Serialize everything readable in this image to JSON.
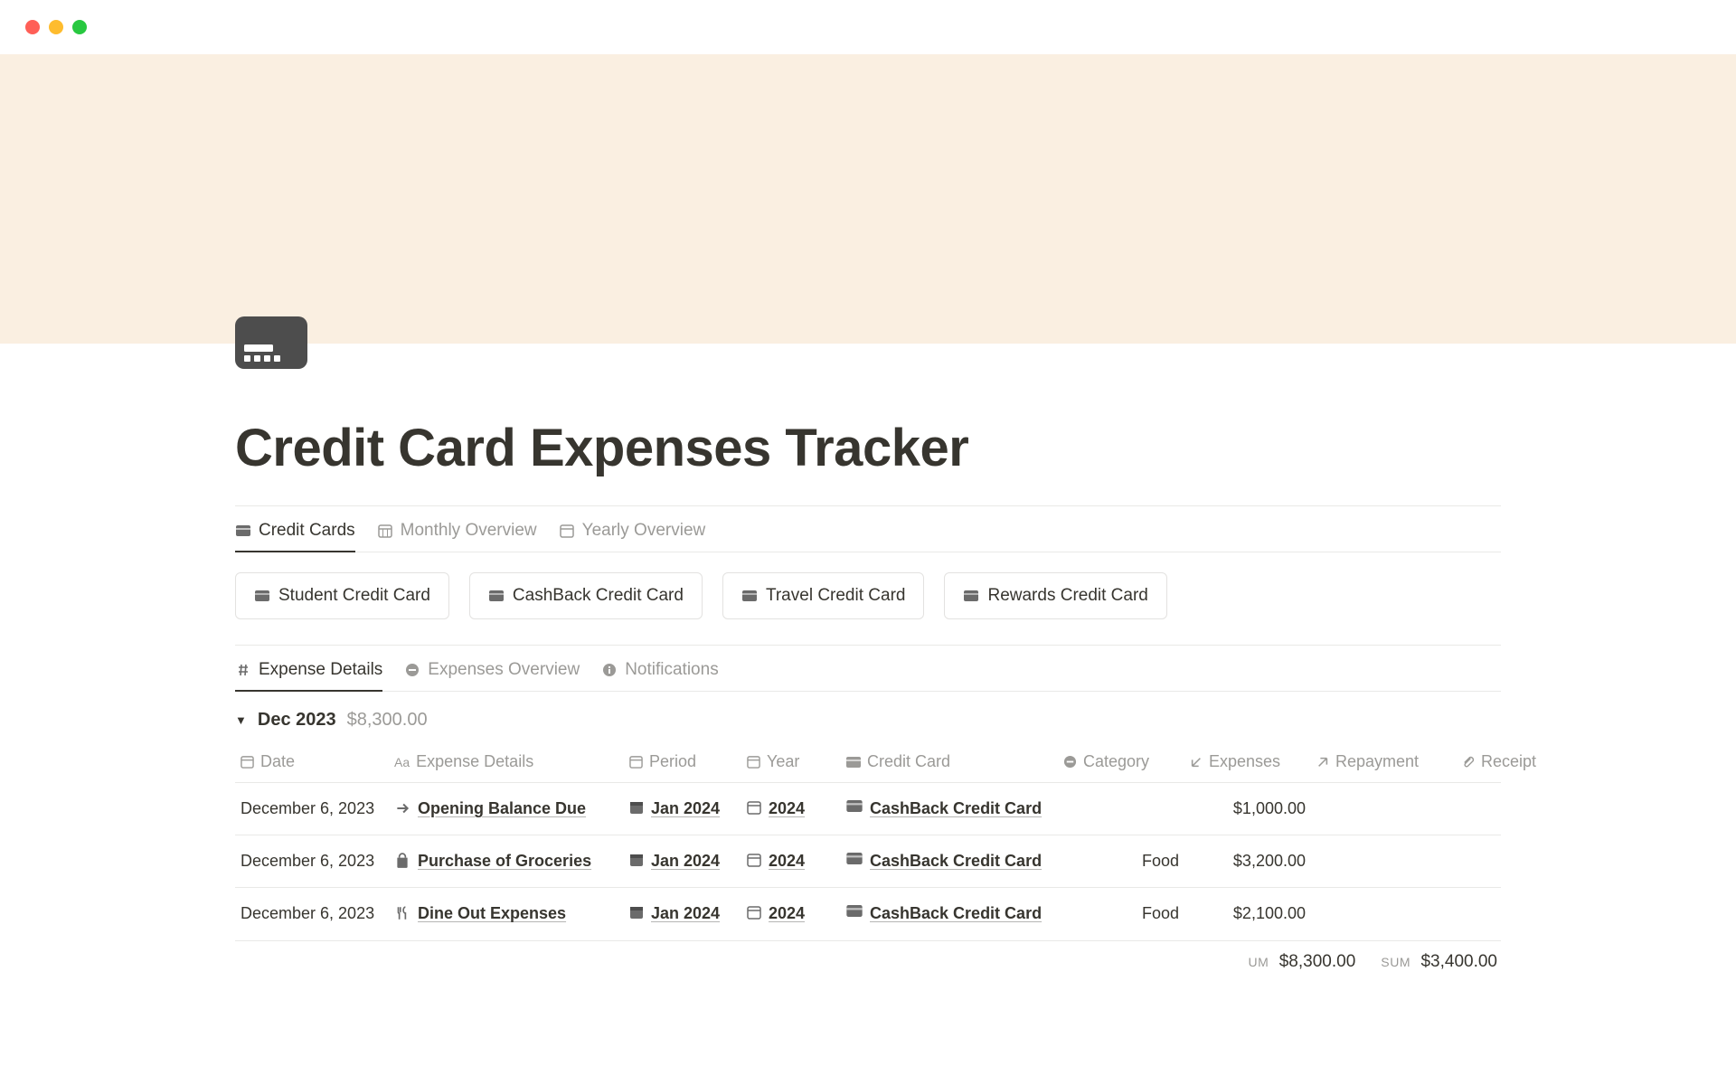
{
  "page": {
    "title": "Credit Card Expenses Tracker"
  },
  "tabs_top": [
    {
      "label": "Credit Cards",
      "icon": "credit-card-icon",
      "active": true
    },
    {
      "label": "Monthly Overview",
      "icon": "calendar-grid-icon",
      "active": false
    },
    {
      "label": "Yearly Overview",
      "icon": "calendar-icon",
      "active": false
    }
  ],
  "card_items": [
    {
      "label": "Student Credit Card"
    },
    {
      "label": "CashBack Credit Card"
    },
    {
      "label": "Travel Credit Card"
    },
    {
      "label": "Rewards Credit Card"
    }
  ],
  "tabs_details": [
    {
      "label": "Expense Details",
      "icon": "hash-icon",
      "active": true
    },
    {
      "label": "Expenses Overview",
      "icon": "minus-circle-icon",
      "active": false
    },
    {
      "label": "Notifications",
      "icon": "info-icon",
      "active": false
    }
  ],
  "group": {
    "name": "Dec 2023",
    "amount": "$8,300.00"
  },
  "columns": [
    {
      "label": "Date",
      "icon": "calendar-icon"
    },
    {
      "label": "Expense Details",
      "icon": "text-icon"
    },
    {
      "label": "Period",
      "icon": "calendar-grid-icon"
    },
    {
      "label": "Year",
      "icon": "calendar-icon"
    },
    {
      "label": "Credit Card",
      "icon": "credit-card-icon"
    },
    {
      "label": "Category",
      "icon": "minus-circle-icon"
    },
    {
      "label": "Expenses",
      "icon": "arrow-down-left-icon"
    },
    {
      "label": "Repayment",
      "icon": "arrow-up-right-icon"
    },
    {
      "label": "Receipt",
      "icon": "paperclip-icon"
    }
  ],
  "rows": [
    {
      "date": "December 6, 2023",
      "details": "Opening Balance Due",
      "details_icon": "arrow-right-icon",
      "period": "Jan 2024",
      "year": "2024",
      "credit_card": "CashBack Credit Card",
      "category": "",
      "expenses": "$1,000.00",
      "repayment": "",
      "receipt": ""
    },
    {
      "date": "December 6, 2023",
      "details": "Purchase of Groceries",
      "details_icon": "bag-icon",
      "period": "Jan 2024",
      "year": "2024",
      "credit_card": "CashBack Credit Card",
      "category": "Food",
      "expenses": "$3,200.00",
      "repayment": "",
      "receipt": ""
    },
    {
      "date": "December 6, 2023",
      "details": "Dine Out Expenses",
      "details_icon": "utensils-icon",
      "period": "Jan 2024",
      "year": "2024",
      "credit_card": "CashBack Credit Card",
      "category": "Food",
      "expenses": "$2,100.00",
      "repayment": "",
      "receipt": ""
    }
  ],
  "footer": {
    "sum1_label": "UM",
    "sum1_value": "$8,300.00",
    "sum2_label": "SUM",
    "sum2_value": "$3,400.00"
  }
}
